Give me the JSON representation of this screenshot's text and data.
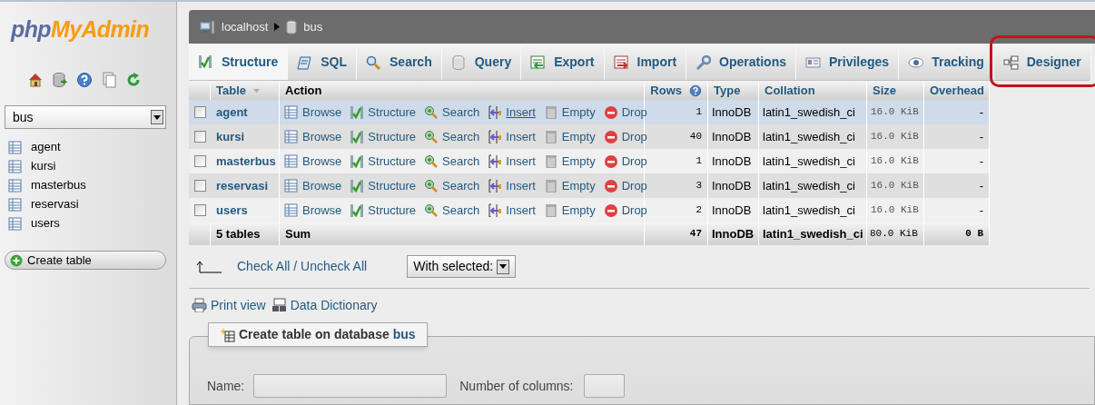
{
  "sidebar": {
    "logo": [
      "php",
      "MyAdmin"
    ],
    "database_select": {
      "value": "bus"
    },
    "tables": [
      "agent",
      "kursi",
      "masterbus",
      "reservasi",
      "users"
    ],
    "create_button": "Create table"
  },
  "breadcrumb": [
    {
      "kind": "server",
      "label": "localhost"
    },
    {
      "kind": "database",
      "label": "bus"
    }
  ],
  "tabs": [
    {
      "kind": "structure",
      "label": "Structure",
      "selected": true,
      "highlighted": false
    },
    {
      "kind": "sql",
      "label": "SQL",
      "selected": false,
      "highlighted": false
    },
    {
      "kind": "search",
      "label": "Search",
      "selected": false,
      "highlighted": false
    },
    {
      "kind": "query",
      "label": "Query",
      "selected": false,
      "highlighted": false
    },
    {
      "kind": "export",
      "label": "Export",
      "selected": false,
      "highlighted": false
    },
    {
      "kind": "import",
      "label": "Import",
      "selected": false,
      "highlighted": false
    },
    {
      "kind": "operations",
      "label": "Operations",
      "selected": false,
      "highlighted": false
    },
    {
      "kind": "privileges",
      "label": "Privileges",
      "selected": false,
      "highlighted": false
    },
    {
      "kind": "tracking",
      "label": "Tracking",
      "selected": false,
      "highlighted": false
    },
    {
      "kind": "designer",
      "label": "Designer",
      "selected": false,
      "highlighted": true
    }
  ],
  "table": {
    "columns": [
      "Table",
      "Action",
      "Rows",
      "Type",
      "Collation",
      "Size",
      "Overhead"
    ],
    "rows": [
      {
        "name": "agent",
        "checked": false,
        "highlighted": true,
        "actions": [
          {
            "kind": "browse",
            "label": "Browse",
            "underlined": false
          },
          {
            "kind": "structure",
            "label": "Structure",
            "underlined": false
          },
          {
            "kind": "search",
            "label": "Search",
            "underlined": false
          },
          {
            "kind": "insert",
            "label": "Insert",
            "underlined": true
          },
          {
            "kind": "empty",
            "label": "Empty",
            "underlined": false
          },
          {
            "kind": "drop",
            "label": "Drop",
            "underlined": false
          }
        ],
        "rows": "1",
        "type": "InnoDB",
        "collation": "latin1_swedish_ci",
        "size": "16.0 KiB",
        "overhead": "-"
      },
      {
        "name": "kursi",
        "checked": false,
        "highlighted": false,
        "actions": [
          {
            "kind": "browse",
            "label": "Browse",
            "underlined": false
          },
          {
            "kind": "structure",
            "label": "Structure",
            "underlined": false
          },
          {
            "kind": "search",
            "label": "Search",
            "underlined": false
          },
          {
            "kind": "insert",
            "label": "Insert",
            "underlined": false
          },
          {
            "kind": "empty",
            "label": "Empty",
            "underlined": false
          },
          {
            "kind": "drop",
            "label": "Drop",
            "underlined": false
          }
        ],
        "rows": "40",
        "type": "InnoDB",
        "collation": "latin1_swedish_ci",
        "size": "16.0 KiB",
        "overhead": "-"
      },
      {
        "name": "masterbus",
        "checked": false,
        "highlighted": false,
        "actions": [
          {
            "kind": "browse",
            "label": "Browse",
            "underlined": false
          },
          {
            "kind": "structure",
            "label": "Structure",
            "underlined": false
          },
          {
            "kind": "search",
            "label": "Search",
            "underlined": false
          },
          {
            "kind": "insert",
            "label": "Insert",
            "underlined": false
          },
          {
            "kind": "empty",
            "label": "Empty",
            "underlined": false
          },
          {
            "kind": "drop",
            "label": "Drop",
            "underlined": false
          }
        ],
        "rows": "1",
        "type": "InnoDB",
        "collation": "latin1_swedish_ci",
        "size": "16.0 KiB",
        "overhead": "-"
      },
      {
        "name": "reservasi",
        "checked": false,
        "highlighted": false,
        "actions": [
          {
            "kind": "browse",
            "label": "Browse",
            "underlined": false
          },
          {
            "kind": "structure",
            "label": "Structure",
            "underlined": false
          },
          {
            "kind": "search",
            "label": "Search",
            "underlined": false
          },
          {
            "kind": "insert",
            "label": "Insert",
            "underlined": false
          },
          {
            "kind": "empty",
            "label": "Empty",
            "underlined": false
          },
          {
            "kind": "drop",
            "label": "Drop",
            "underlined": false
          }
        ],
        "rows": "3",
        "type": "InnoDB",
        "collation": "latin1_swedish_ci",
        "size": "16.0 KiB",
        "overhead": "-"
      },
      {
        "name": "users",
        "checked": false,
        "highlighted": false,
        "actions": [
          {
            "kind": "browse",
            "label": "Browse",
            "underlined": false
          },
          {
            "kind": "structure",
            "label": "Structure",
            "underlined": false
          },
          {
            "kind": "search",
            "label": "Search",
            "underlined": false
          },
          {
            "kind": "insert",
            "label": "Insert",
            "underlined": false
          },
          {
            "kind": "empty",
            "label": "Empty",
            "underlined": false
          },
          {
            "kind": "drop",
            "label": "Drop",
            "underlined": false
          }
        ],
        "rows": "2",
        "type": "InnoDB",
        "collation": "latin1_swedish_ci",
        "size": "16.0 KiB",
        "overhead": "-"
      }
    ],
    "footer": {
      "name": "5 tables",
      "action": "Sum",
      "rows": "47",
      "type": "InnoDB",
      "collation": "latin1_swedish_ci",
      "size": "80.0 KiB",
      "overhead": "0 B"
    }
  },
  "check_all": "Check All / Uncheck All",
  "with_selected": "With selected:",
  "links": [
    {
      "kind": "print",
      "label": "Print view"
    },
    {
      "kind": "dictionary",
      "label": "Data Dictionary"
    }
  ],
  "create_form": {
    "legend": "Create table on database",
    "database": "bus",
    "name_label": "Name:",
    "columns_label": "Number of columns:"
  }
}
